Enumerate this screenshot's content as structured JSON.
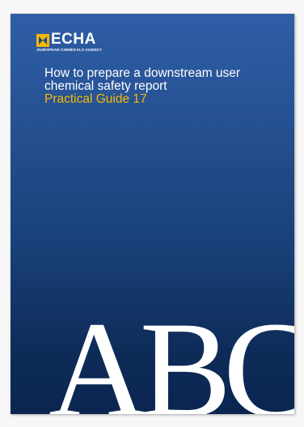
{
  "logo": {
    "word": "ECHA",
    "subtitle": "EUROPEAN CHEMICALS AGENCY",
    "mark_icon": "echa-logo-icon",
    "mark_color": "#f5b800"
  },
  "cover": {
    "title": "How to prepare a downstream user chemical safety report",
    "subtitle": "Practical Guide 17",
    "big_letters": "ABC",
    "title_color": "#ffffff",
    "subtitle_color": "#f5b800",
    "background_top": "#2f5ea7",
    "background_bottom": "#0a2550"
  }
}
